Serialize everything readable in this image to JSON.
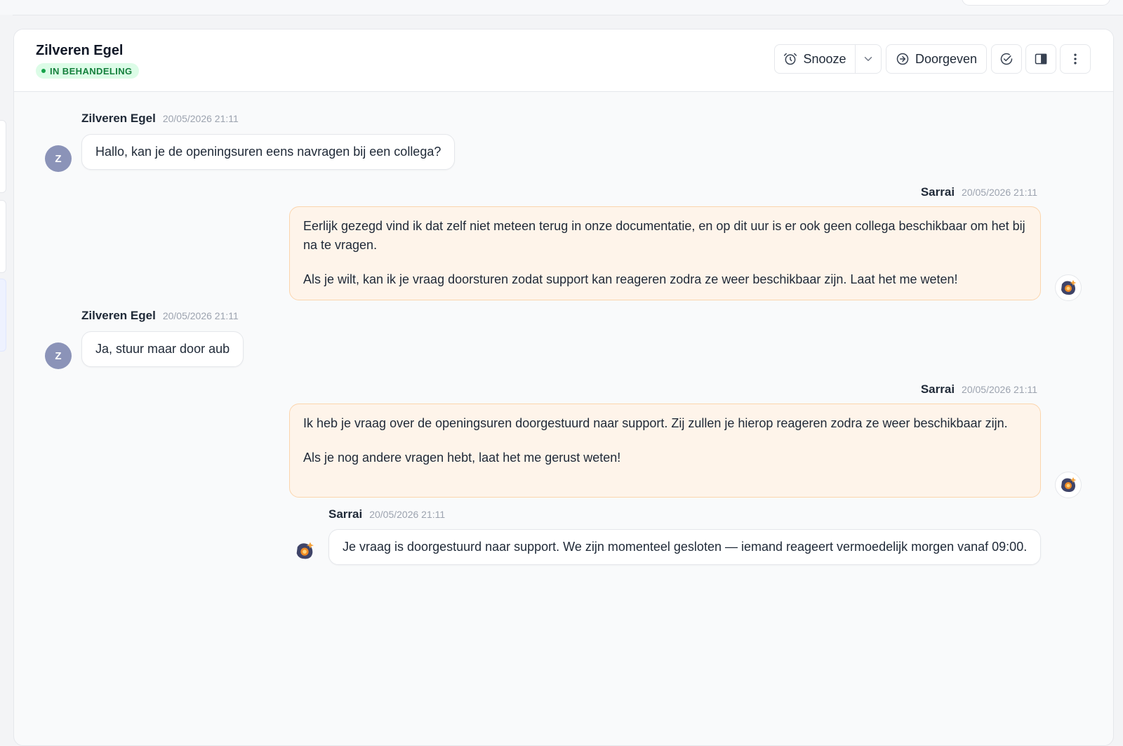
{
  "header": {
    "title": "Zilveren Egel",
    "status": "IN BEHANDELING",
    "snooze_label": "Snooze",
    "forward_label": "Doorgeven"
  },
  "messages": [
    {
      "sender": "Zilveren Egel",
      "time": "20/05/2026 21:11",
      "avatar": "Z",
      "text": "Hallo, kan je de openingsuren eens navragen bij een collega?"
    },
    {
      "sender": "Sarrai",
      "time": "20/05/2026 21:11",
      "paragraphs": [
        "Eerlijk gezegd vind ik dat zelf niet meteen terug in onze documentatie, en op dit uur is er ook geen collega beschikbaar om het bij na te vragen.",
        "Als je wilt, kan ik je vraag doorsturen zodat support kan reageren zodra ze weer beschikbaar zijn. Laat het me weten!"
      ]
    },
    {
      "sender": "Zilveren Egel",
      "time": "20/05/2026 21:11",
      "avatar": "Z",
      "text": "Ja, stuur maar door aub"
    },
    {
      "sender": "Sarrai",
      "time": "20/05/2026 21:11",
      "paragraphs": [
        "Ik heb je vraag over de openingsuren doorgestuurd naar support. Zij zullen je hierop reageren zodra ze weer beschikbaar zijn.",
        "Als je nog andere vragen hebt, laat het me gerust weten!"
      ]
    },
    {
      "sender": "Sarrai",
      "time": "20/05/2026 21:11",
      "text": "Je vraag is doorgestuurd naar support. We zijn momenteel gesloten — iemand reageert vermoedelijk morgen vanaf 09:00."
    }
  ],
  "colors": {
    "status_bg": "#dcfce7",
    "status_text": "#15803d",
    "agent_bubble_bg": "#fef4ea",
    "agent_bubble_border": "#fbd5ad",
    "visitor_avatar": "#8b93b8"
  },
  "icons": {
    "snooze": "alarm-clock-icon",
    "snooze_menu": "chevron-down-icon",
    "forward": "arrow-circle-right-icon",
    "resolve": "check-circle-icon",
    "sidebar_toggle": "sidebar-panel-icon",
    "more": "vertical-dots-icon"
  }
}
